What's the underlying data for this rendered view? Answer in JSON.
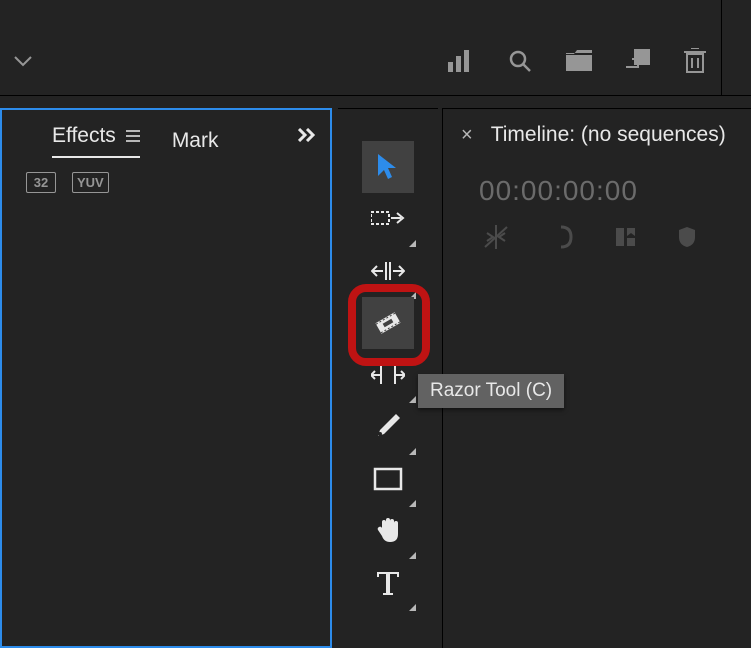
{
  "topbar": {
    "icons": [
      "bars-icon",
      "search-icon",
      "folder-icon",
      "l-shape-icon",
      "trash-icon"
    ]
  },
  "effects": {
    "tab_active": "Effects",
    "tab_secondary": "Mark",
    "badges": [
      "32",
      "YUV"
    ]
  },
  "tools": [
    {
      "name": "selection-tool",
      "icon": "arrow"
    },
    {
      "name": "track-select-tool",
      "icon": "dashed"
    },
    {
      "name": "ripple-edit-tool",
      "icon": "ripple"
    },
    {
      "name": "razor-tool",
      "icon": "razor"
    },
    {
      "name": "slip-tool",
      "icon": "slip"
    },
    {
      "name": "pen-tool",
      "icon": "pen"
    },
    {
      "name": "rectangle-tool",
      "icon": "rect"
    },
    {
      "name": "hand-tool",
      "icon": "hand"
    },
    {
      "name": "type-tool",
      "icon": "type"
    }
  ],
  "timeline": {
    "title": "Timeline: (no sequences)",
    "timecode": "00:00:00:00"
  },
  "tooltip": {
    "text": "Razor Tool (C)"
  }
}
